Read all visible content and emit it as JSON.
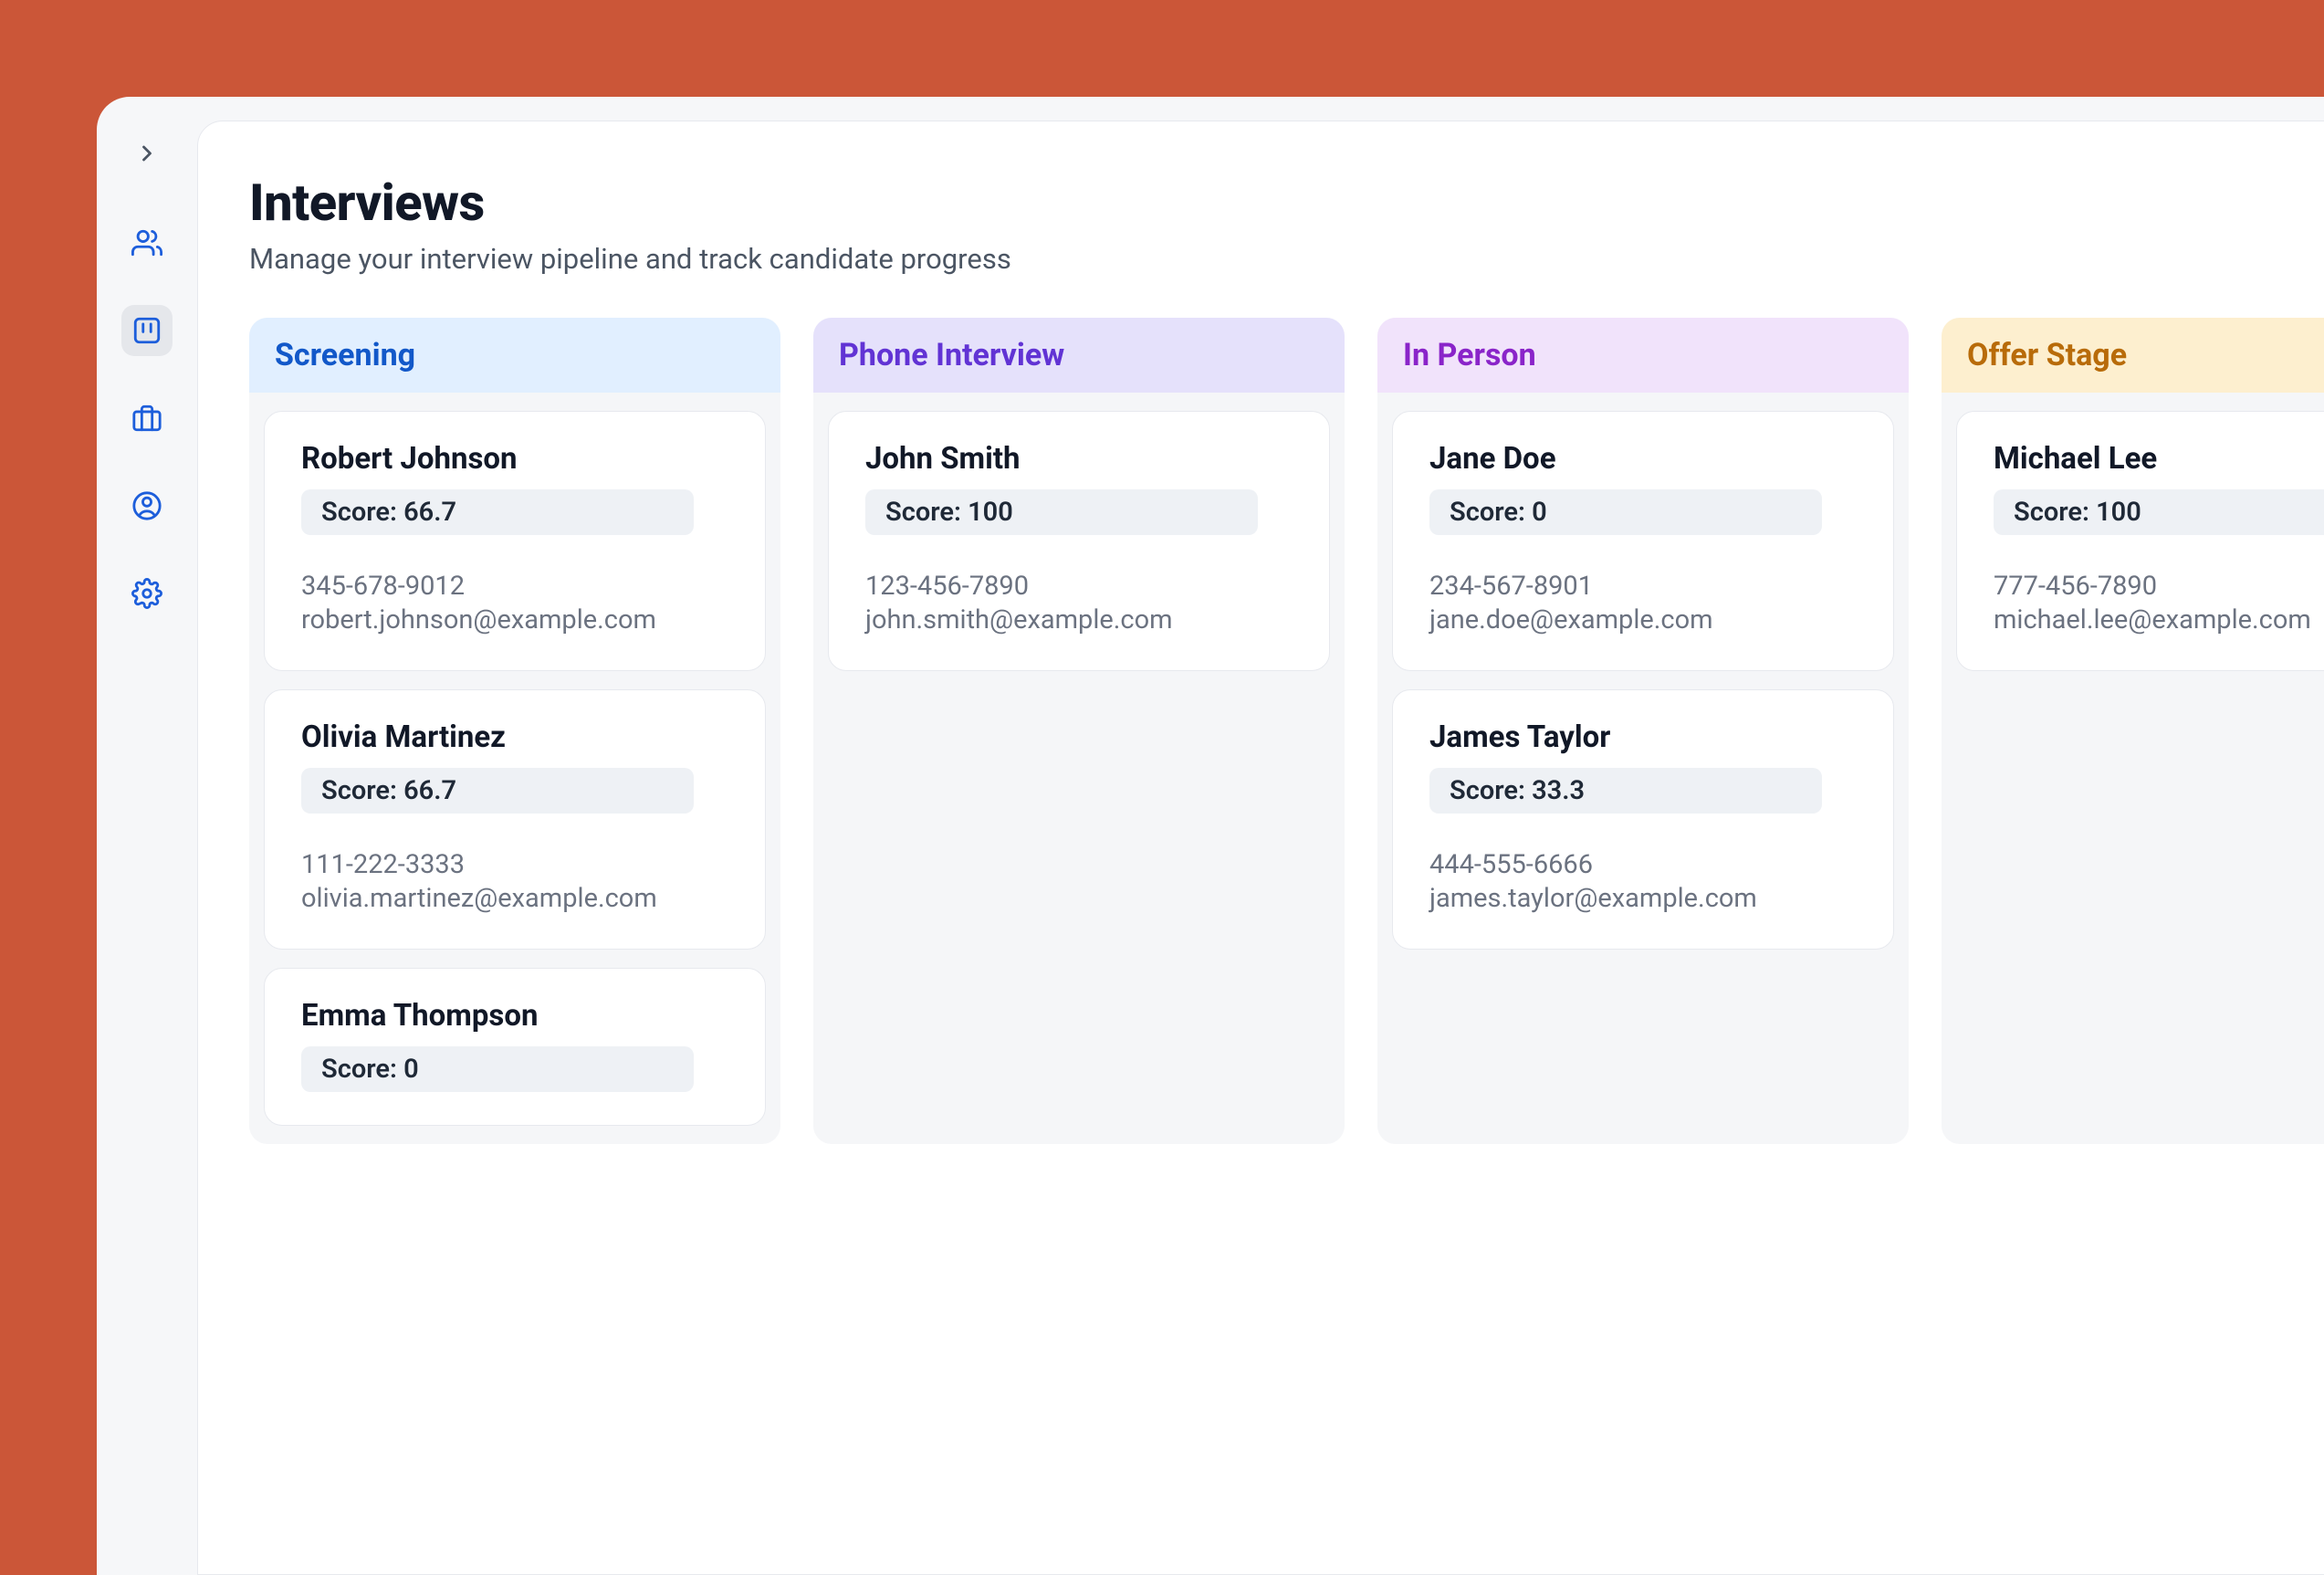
{
  "header": {
    "title": "Interviews",
    "subtitle": "Manage your interview pipeline and track candidate progress"
  },
  "score_prefix": "Score: ",
  "columns": [
    {
      "key": "screening",
      "label": "Screening",
      "cards": [
        {
          "name": "Robert Johnson",
          "score": "66.7",
          "phone": "345-678-9012",
          "email": "robert.johnson@example.com"
        },
        {
          "name": "Olivia Martinez",
          "score": "66.7",
          "phone": "111-222-3333",
          "email": "olivia.martinez@example.com"
        },
        {
          "name": "Emma Thompson",
          "score": "0",
          "phone": "",
          "email": ""
        }
      ]
    },
    {
      "key": "phone",
      "label": "Phone Interview",
      "cards": [
        {
          "name": "John Smith",
          "score": "100",
          "phone": "123-456-7890",
          "email": "john.smith@example.com"
        }
      ]
    },
    {
      "key": "inperson",
      "label": "In Person",
      "cards": [
        {
          "name": "Jane Doe",
          "score": "0",
          "phone": "234-567-8901",
          "email": "jane.doe@example.com"
        },
        {
          "name": "James Taylor",
          "score": "33.3",
          "phone": "444-555-6666",
          "email": "james.taylor@example.com"
        }
      ]
    },
    {
      "key": "offer",
      "label": "Offer Stage",
      "cards": [
        {
          "name": "Michael Lee",
          "score": "100",
          "phone": "777-456-7890",
          "email": "michael.lee@example.com"
        }
      ]
    }
  ]
}
